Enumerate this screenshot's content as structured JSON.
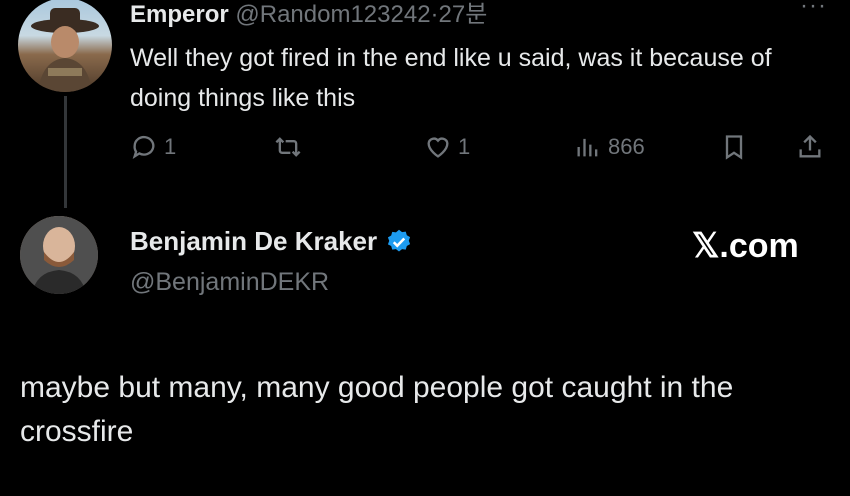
{
  "tweet": {
    "display_name": "Emperor",
    "handle": "@Random123242",
    "separator": "·",
    "time": "27분",
    "more": "···",
    "text": "Well they got fired in the end like u said, was it because of doing things like this",
    "actions": {
      "reply_count": "1",
      "like_count": "1",
      "views": "866"
    }
  },
  "quoted": {
    "display_name": "Benjamin De Kraker",
    "verified": true,
    "handle": "@BenjaminDEKR",
    "source": "𝕏.com",
    "text": "maybe but many, many good people got caught in the crossfire"
  },
  "colors": {
    "background": "#000000",
    "text": "#e7e9ea",
    "muted": "#71767b",
    "verified": "#1d9bf0"
  },
  "icons": [
    "reply-icon",
    "retweet-icon",
    "like-icon",
    "views-icon",
    "bookmark-icon",
    "share-icon",
    "verified-badge-icon"
  ]
}
